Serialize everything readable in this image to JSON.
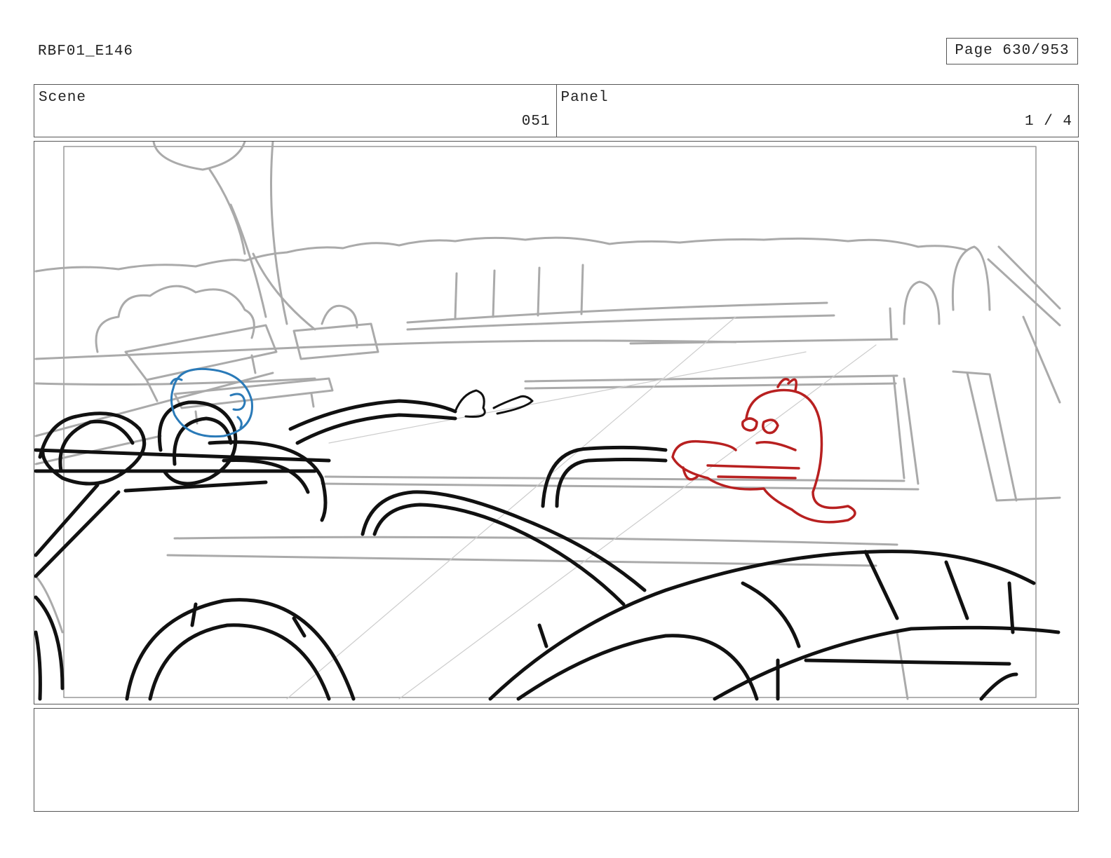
{
  "header": {
    "doc_id": "RBF01_E146",
    "page_label": "Page 630/953"
  },
  "scene": {
    "label": "Scene",
    "value": "051"
  },
  "panel": {
    "label": "Panel",
    "value": "1 / 4"
  },
  "sketch": {
    "line_colors": {
      "background": "#aaaaaa",
      "foreground": "#111111",
      "blue_character": "#2a7ab8",
      "red_character": "#b82020"
    }
  },
  "notes": {
    "text": ""
  }
}
